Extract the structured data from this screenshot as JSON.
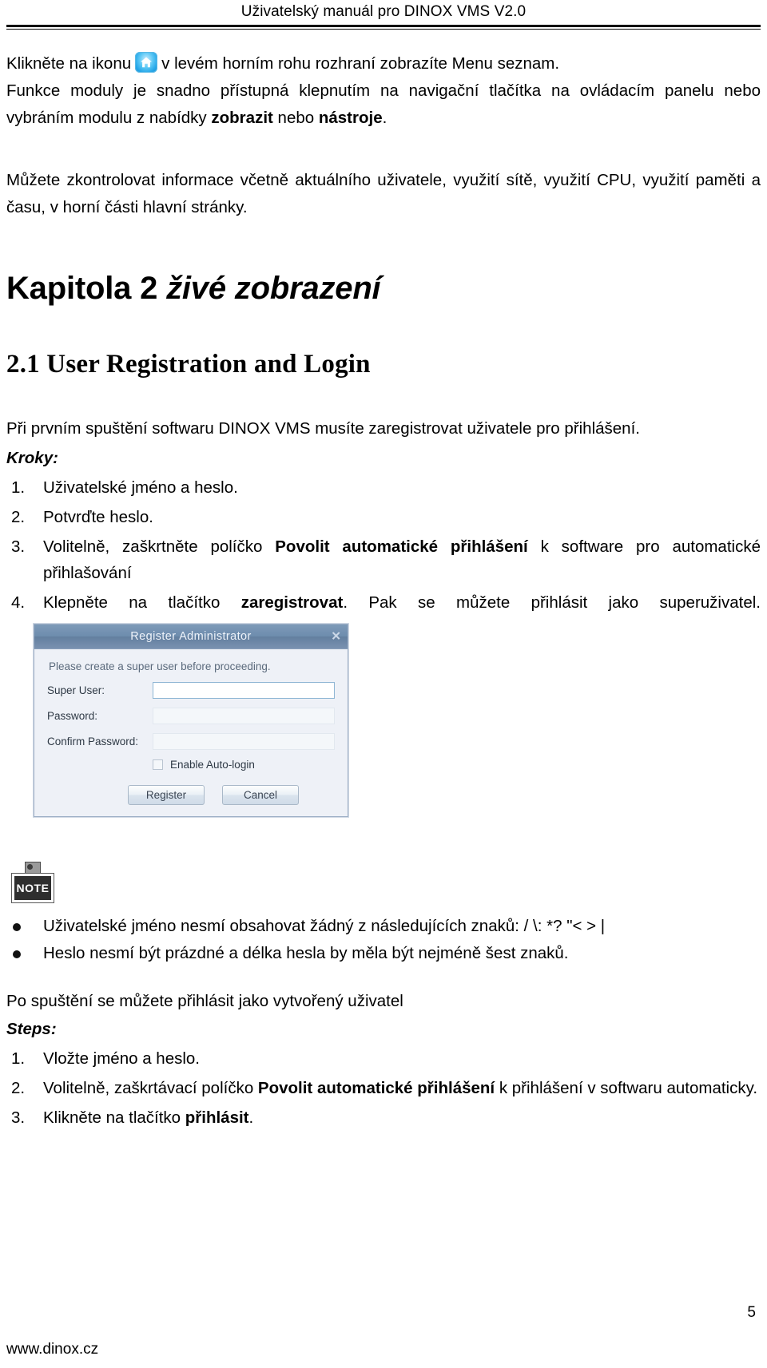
{
  "header": {
    "running_title": "Uživatelský manuál pro DINOX VMS V2.0"
  },
  "intro": {
    "line1_before_icon": "Klikněte na ikonu",
    "home_icon_name": "home-icon",
    "line1_after_icon": "v levém horním rohu rozhraní zobrazíte Menu seznam.",
    "line2": "Funkce moduly je snadno přístupná klepnutím na navigační tlačítka na ovládacím panelu nebo vybráním modulu z nabídky",
    "line2_bold_1": "zobrazit",
    "line2_mid": "nebo",
    "line2_bold_2": "nástroje",
    "line2_end": ".",
    "paragraph2": "Můžete zkontrolovat informace včetně aktuálního uživatele, využití sítě, využití CPU, využití paměti a času, v horní části hlavní stránky."
  },
  "chapter": {
    "number_text": "Kapitola 2 ",
    "title_text": "živé zobrazení"
  },
  "section": {
    "title": "2.1 User Registration and Login",
    "intro": "Při prvním spuštění softwaru DINOX VMS musíte zaregistrovat uživatele pro přihlášení.",
    "steps_label": "Kroky:",
    "steps": [
      {
        "text": "Uživatelské jméno a heslo."
      },
      {
        "text": "Potvrďte heslo."
      },
      {
        "prefix": "Volitelně, zaškrtněte políčko ",
        "bold": "Povolit automatické přihlášení",
        "suffix": " k software pro automatické",
        "second_line": "přihlašování"
      },
      {
        "prefix": "Klepněte na tlačítko ",
        "bold": "zaregistrovat",
        "suffix": ". Pak se můžete přihlásit jako superuživatel."
      }
    ]
  },
  "dialog": {
    "title": "Register Administrator",
    "close_icon": "close-icon",
    "hint": "Please create a super user before proceeding.",
    "fields": [
      {
        "label": "Super User:",
        "value": "",
        "placeholder": ""
      },
      {
        "label": "Password:",
        "value": "",
        "placeholder": ""
      },
      {
        "label": "Confirm Password:",
        "value": "",
        "placeholder": ""
      }
    ],
    "checkbox_label": "Enable Auto-login",
    "checkbox_checked": false,
    "buttons": {
      "register": "Register",
      "cancel": "Cancel"
    },
    "colors": {
      "titlebar": "#6e8dae",
      "body": "#eef1f7",
      "border": "#9fb0c6"
    }
  },
  "note": {
    "icon_label": "NOTE",
    "bullets": [
      "Uživatelské jméno nesmí obsahovat žádný z následujících znaků: / \\: *? \"< > |",
      "Heslo nesmí být prázdné a délka hesla by měla být nejméně šest znaků."
    ]
  },
  "login_section": {
    "intro": "Po spuštění se můžete přihlásit jako vytvořený uživatel",
    "steps_label": "Steps:",
    "steps": [
      {
        "text": "Vložte jméno a heslo."
      },
      {
        "prefix": "Volitelně, zaškrtávací políčko ",
        "bold": "Povolit automatické přihlášení",
        "suffix": " k přihlášení v softwaru automaticky."
      },
      {
        "prefix": "Klikněte na tlačítko ",
        "bold": "přihlásit",
        "suffix": "."
      }
    ]
  },
  "footer": {
    "page_number": "5",
    "url": "www.dinox.cz"
  }
}
